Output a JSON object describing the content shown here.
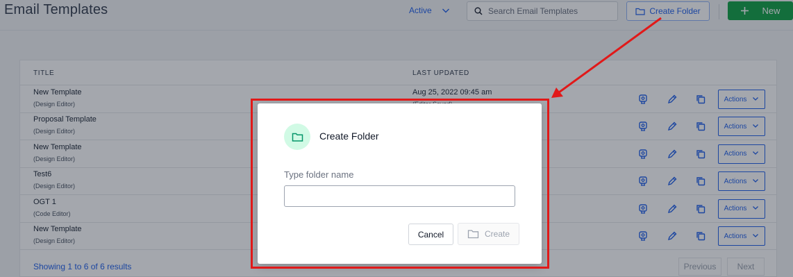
{
  "header": {
    "title": "Email Templates",
    "filter_label": "Active",
    "search_placeholder": "Search Email Templates",
    "create_folder_label": "Create Folder",
    "new_label": "New"
  },
  "table": {
    "col_title": "TITLE",
    "col_last_updated": "LAST UPDATED",
    "rows": [
      {
        "name": "New Template",
        "editor": "(Design Editor)",
        "date": "Aug 25, 2022 09:45 am",
        "sub": "(Editor Saved)"
      },
      {
        "name": "Proposal Template",
        "editor": "(Design Editor)"
      },
      {
        "name": "New Template",
        "editor": "(Design Editor)"
      },
      {
        "name": "Test6",
        "editor": "(Design Editor)"
      },
      {
        "name": "OGT 1",
        "editor": "(Code Editor)"
      },
      {
        "name": "New Template",
        "editor": "(Design Editor)"
      }
    ],
    "actions_label": "Actions",
    "footer_text": "Showing 1 to 6 of 6 results",
    "previous_label": "Previous",
    "next_label": "Next"
  },
  "modal": {
    "title": "Create Folder",
    "field_label": "Type folder name",
    "field_value": "",
    "cancel_label": "Cancel",
    "create_label": "Create"
  },
  "icons": {
    "filter": "chevron-down-icon",
    "search": "search-icon",
    "create_folder": "folder-icon",
    "new": "plus-icon",
    "row_preview": "preview-icon",
    "row_edit": "pencil-icon",
    "row_copy": "copy-icon",
    "actions": "chevron-down-icon",
    "modal": "folder-icon"
  },
  "colors": {
    "accent_blue": "#2563eb",
    "new_button_green": "#16a34a",
    "modal_icon_bg": "#d1fae5",
    "modal_icon_green": "#059669",
    "annotation_red": "#e11919"
  }
}
